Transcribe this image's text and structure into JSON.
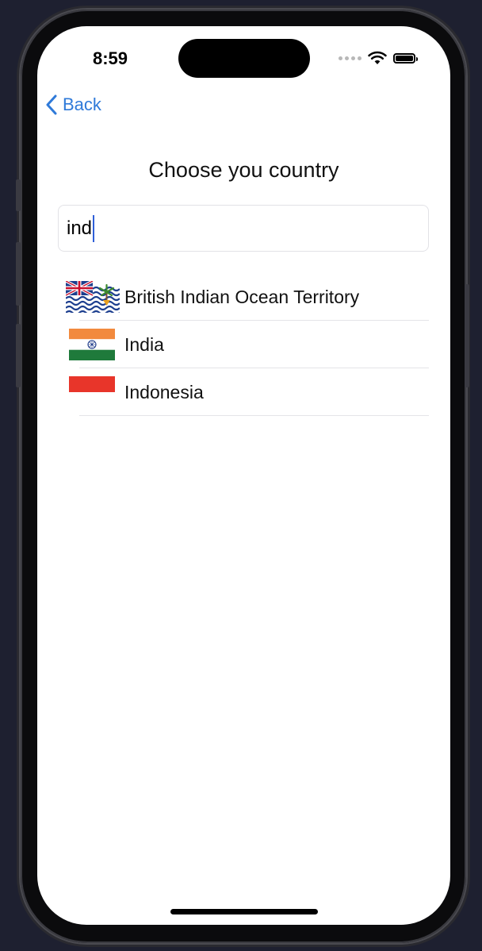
{
  "status_bar": {
    "time": "8:59"
  },
  "nav": {
    "back_label": "Back"
  },
  "page": {
    "title": "Choose you country"
  },
  "search": {
    "value": "ind"
  },
  "countries": [
    {
      "name": "British Indian Ocean Territory",
      "flag_icon": "british-indian-ocean-territory-flag-icon"
    },
    {
      "name": "India",
      "flag_icon": "india-flag-icon"
    },
    {
      "name": "Indonesia",
      "flag_icon": "indonesia-flag-icon"
    }
  ],
  "colors": {
    "accent": "#2f7ad9",
    "caret": "#2f5fd8",
    "separator": "#e4e4e8",
    "background": "#ffffff"
  }
}
